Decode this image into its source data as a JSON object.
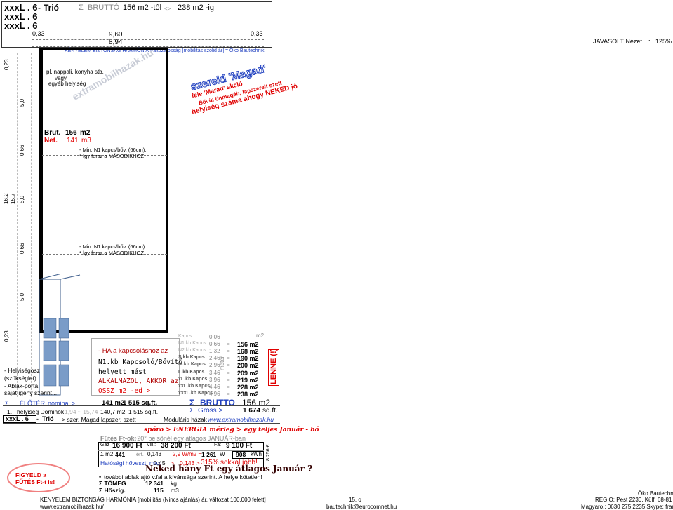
{
  "header": {
    "size_rows": [
      "xxxL . 6",
      "xxxL . 6",
      "xxxL . 6"
    ],
    "dash": "-",
    "model": "Trió",
    "sigma": "Σ",
    "brutto": "BRUTTÓ",
    "range_from": "156 m2 -től",
    "arrows": "<>",
    "range_to": "238 m2 -ig"
  },
  "dimensions": {
    "left_margin": "0,33",
    "right_margin": "0,33",
    "outer_width": "9,60",
    "inner_width": "8,94",
    "left_side": [
      "0,23",
      "5,0",
      "0,66",
      "16,2",
      "15,7",
      "5,0",
      "0,66",
      "5,0",
      "0,23"
    ]
  },
  "tagline": "KÉNYELEM  BIZTONSÁG  HARMÓNIA  Változatosság  [mobilitás szolid ár]  = Öko Bautechnik",
  "view": {
    "label": "JAVASOLT Nézet",
    "colon": ":",
    "zoom": "125%"
  },
  "plan": {
    "room_note": [
      "pl. nappali, konyha stb.",
      "vagy",
      "egyéb helyiség"
    ],
    "brut_label": "Brut.",
    "brut_value": "156",
    "brut_unit": "m2",
    "net_label": "Net.",
    "net_value": "141",
    "net_unit": "m3",
    "min_note_1": [
      "- Min. N1 kapcs/bőv. (66cm).",
      "* Így fersz   a   MÁSODIKHOZ"
    ],
    "min_note_2": [
      "- Min. N1 kapcs/bőv. (66cm).",
      "* Így fersz   a   MÁSODIKHOZ"
    ],
    "watermark": "extramobilhazak.hu",
    "left_notes": [
      "- Helyiségosz",
      "(szükséglet)",
      "- Ablak-porta",
      "saját igény szerint..."
    ]
  },
  "stamp": {
    "line1": "szereld 'Magad'",
    "line2": "fele 'Marad' akció",
    "line3": "Bővül önmagáb, lapszerelt szett",
    "line4": "helyiség száma ahogy NEKED jó"
  },
  "connect": {
    "lines": [
      "- HA a kapcsoláshoz az",
      "N1.kb Kapcsoló/Bővítő",
      "helyett mást",
      "ALKALMAZOL, AKKOR az",
      "ÖSSZ m2 -ed  >"
    ]
  },
  "kapcs_table": {
    "unit_header": "m2",
    "meter_label": "méter",
    "lenne": "LENNE (!)",
    "rows": [
      {
        "name": "Kapcs",
        "val": "0,06",
        "sign": "",
        "area": ""
      },
      {
        "name": "N1.kb Kapcs",
        "val": "0,66",
        "sign": "=",
        "area": "156 m2"
      },
      {
        "name": "N2.kb Kapcs",
        "val": "1,32",
        "sign": "=",
        "area": "168 m2"
      },
      {
        "name": "S.kb Kapcs",
        "val": "2,46",
        "sign": "=",
        "area": "190 m2"
      },
      {
        "name": "M.kb Kapcs",
        "val": "2,96",
        "sign": "=",
        "area": "200 m2"
      },
      {
        "name": "L.kb Kapcs",
        "val": "3,46",
        "sign": "=",
        "area": "209 m2"
      },
      {
        "name": "xL.kb Kapcs",
        "val": "3,96",
        "sign": "=",
        "area": "219 m2"
      },
      {
        "name": "xxL.kb Kapcs",
        "val": "4,46",
        "sign": "=",
        "area": "228 m2"
      },
      {
        "name": "xxxL.kb Kapcs",
        "val": "4,96",
        "sign": "=",
        "area": "238 m2"
      }
    ]
  },
  "summary": {
    "sigma": "Σ",
    "eloter": "ÉLŐTÉR",
    "nominal": "nominal >",
    "eloter_m2": "141 m2",
    "eloter_sqft": "1 515 sq.ft.",
    "brutto_label": "BRUTTO",
    "brutto_value": "156 m2",
    "num": "1.",
    "helyiseg": "helyiség Dominók",
    "helyiseg_grey": "1,94 ~ 15,74",
    "helyiseg_m2": "140,7 m2",
    "helyiseg_sqft": "1 515 sq.ft.",
    "gross_label": "Gross >",
    "gross_value": "1 674",
    "gross_unit": "sq.ft.",
    "model_size": "xxxL . 6",
    "model_dash": "-",
    "model_name": "Trió",
    "szer": "> szer. Magad lapszer. szett",
    "moduláris": "Moduláris házak",
    "moduláris_arrow": ">",
    "site": "www.extramobilhazak.hu"
  },
  "energy": {
    "title": "spóro > ENERGIA mérleg  >  egy teljes  Január - bó",
    "futes_label": "Fűtés Ft-ok:",
    "futes_note": "+20°  belsőnél egy átlagos JANUÁR-ban",
    "gaz_label": "Gáz",
    "gaz_value": "16 900 Ft",
    "vill_label": "Vill.:",
    "vill_value": "38 200 Ft",
    "fa_label": "Fa:",
    "fa_value": "9 100 Ft",
    "m2_label": "Σ m2",
    "m2_value": "441",
    "ert_label": "ért.",
    "ert_value": "0,143",
    "wm2": "2,9 W/m2 =",
    "watt": "1 261",
    "w_unit": "W",
    "kwh": "908",
    "kwh_unit": "kWh",
    "side_value": "8 256 €",
    "hatosagi_label": "Hatósági hőveszt. max",
    "hatosagi_value": "0,45",
    "gt": ">",
    "ratio": "0,143 >",
    "percent": "315%",
    "jobb": "sokkal jobb!"
  },
  "neked": {
    "title": "Neked  hány  Ft  egy  átlagos  Január ?",
    "extra": "további ablak ajtó v.fal  a kívánsága szerint.  A helye kötetlen!",
    "tomeg_label": "Σ TÖMEG",
    "tomeg_value": "12 341",
    "tomeg_unit": "kg",
    "hoszig_label": "Σ Hőszig.",
    "hoszig_value": "115",
    "hoszig_unit": "m3"
  },
  "warning": "FIGYELD a FŰTÉS Ft-t is!",
  "footer": {
    "line1": "KÉNYELEM  BIZTONSÁG  HARMÓNIA  [mobilitás  (Nincs ajánlás) ár, változat 100.000 felett]",
    "line2": "www.extramobilhazak.hu/",
    "page": "15. o",
    "email": "bautechnik@eurocomnet.hu",
    "company": "Öko Bautechnik",
    "region": "REGIO: Pest  2230. Külf. 68-81 hrsz",
    "contact": "Magyaro.: 0630 275 2235  Skype: fransis69"
  },
  "colors": {
    "blue": "#1f3fbf",
    "red": "#e00000",
    "darkred": "#b00000"
  }
}
